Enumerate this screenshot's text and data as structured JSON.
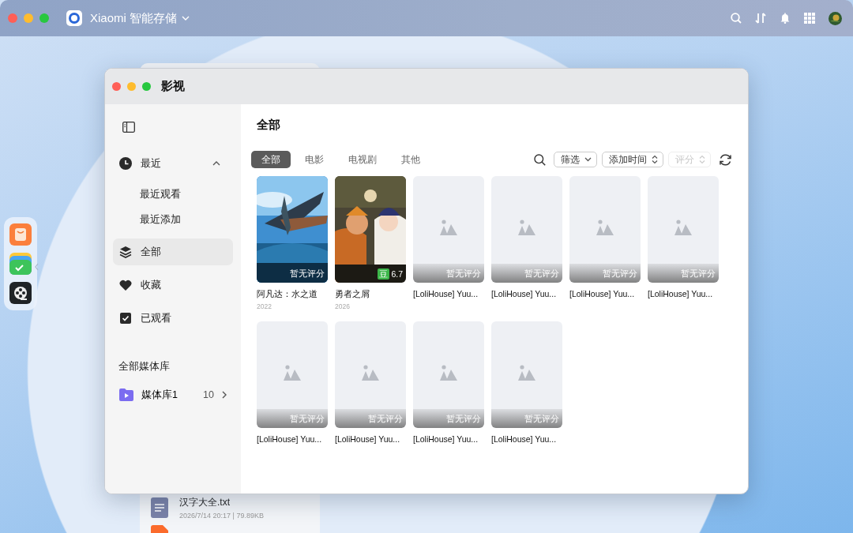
{
  "topbar": {
    "app_title": "Xiaomi 智能存储"
  },
  "background_file": {
    "name": "汉字大全.txt",
    "meta": "2026/7/14 20:17 | 79.89KB"
  },
  "window": {
    "title": "影视"
  },
  "sidebar": {
    "items": [
      {
        "label": "最近",
        "selected": false,
        "expanded": true,
        "children": [
          {
            "label": "最近观看",
            "selected": false
          },
          {
            "label": "最近添加",
            "selected": false
          }
        ]
      },
      {
        "label": "全部",
        "selected": true
      },
      {
        "label": "收藏",
        "selected": false
      },
      {
        "label": "已观看",
        "selected": false
      }
    ],
    "section_title": "全部媒体库",
    "libraries": [
      {
        "label": "媒体库1",
        "count": "10"
      }
    ]
  },
  "content": {
    "heading": "全部",
    "tabs": [
      {
        "label": "全部",
        "selected": true
      },
      {
        "label": "电影",
        "selected": false
      },
      {
        "label": "电视剧",
        "selected": false
      },
      {
        "label": "其他",
        "selected": false
      }
    ],
    "filter": {
      "label": "筛选"
    },
    "sorts": [
      {
        "label": "添加时间",
        "disabled": false
      },
      {
        "label": "评分",
        "disabled": true
      }
    ],
    "cards": [
      {
        "kind": "poster",
        "title": "阿凡达：水之道",
        "year": "2022",
        "rating": "暂无评分"
      },
      {
        "kind": "poster",
        "title": "勇者之屑",
        "year": "2026",
        "rating": "6.7",
        "badge": "豆"
      },
      {
        "kind": "placeholder",
        "title": "[LoliHouse] Yuu...",
        "rating": "暂无评分"
      },
      {
        "kind": "placeholder",
        "title": "[LoliHouse] Yuu...",
        "rating": "暂无评分"
      },
      {
        "kind": "placeholder",
        "title": "[LoliHouse] Yuu...",
        "rating": "暂无评分"
      },
      {
        "kind": "placeholder",
        "title": "[LoliHouse] Yuu...",
        "rating": "暂无评分"
      },
      {
        "kind": "placeholder",
        "title": "[LoliHouse] Yuu...",
        "rating": "暂无评分"
      },
      {
        "kind": "placeholder",
        "title": "[LoliHouse] Yuu...",
        "rating": "暂无评分"
      },
      {
        "kind": "placeholder",
        "title": "[LoliHouse] Yuu...",
        "rating": "暂无评分"
      },
      {
        "kind": "placeholder",
        "title": "[LoliHouse] Yuu...",
        "rating": "暂无评分"
      }
    ]
  }
}
